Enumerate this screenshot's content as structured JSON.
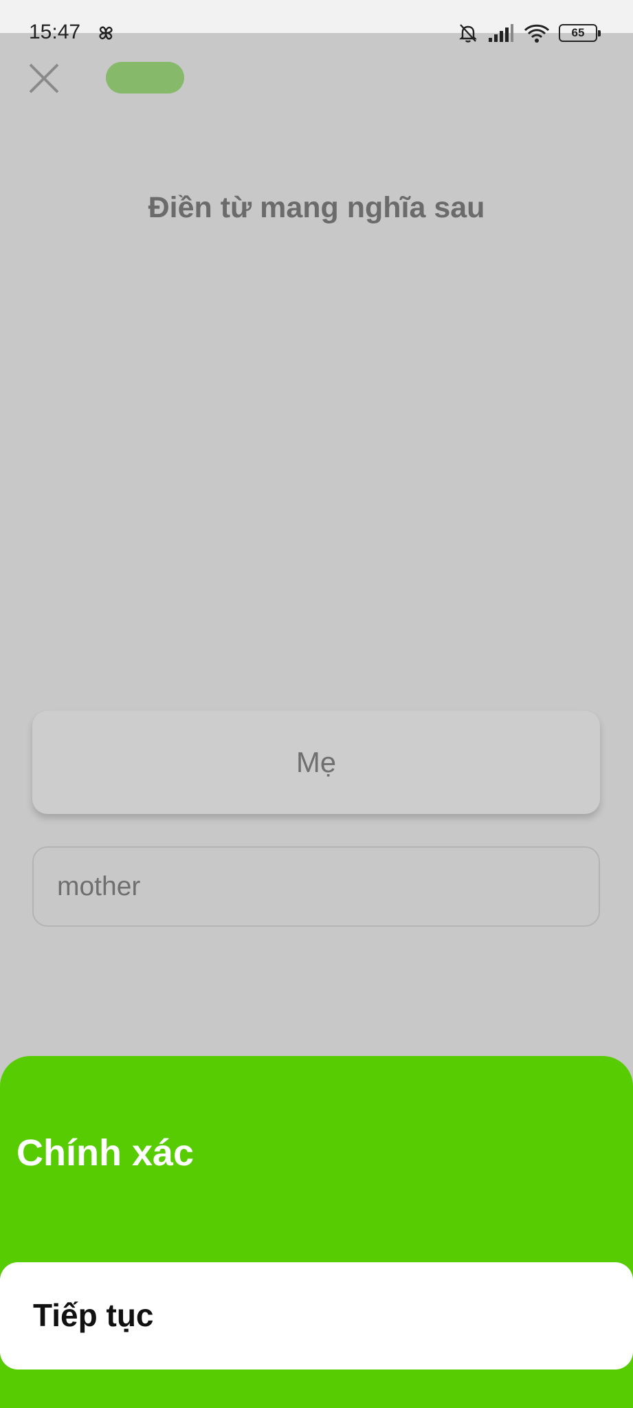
{
  "status_bar": {
    "time": "15:47",
    "battery": "65",
    "icons": [
      "pinwheel-icon",
      "bell-muted-icon",
      "signal-icon",
      "wifi-icon",
      "battery-icon"
    ]
  },
  "lesson": {
    "close_icon": "close-icon",
    "progress_color": "#86b96a",
    "prompt_title": "Điền từ mang nghĩa sau",
    "word_card": "Mẹ",
    "answer_input_value": "mother"
  },
  "feedback": {
    "title": "Chính xác",
    "continue_label": "Tiếp tục",
    "accent_color": "#58cc02"
  }
}
